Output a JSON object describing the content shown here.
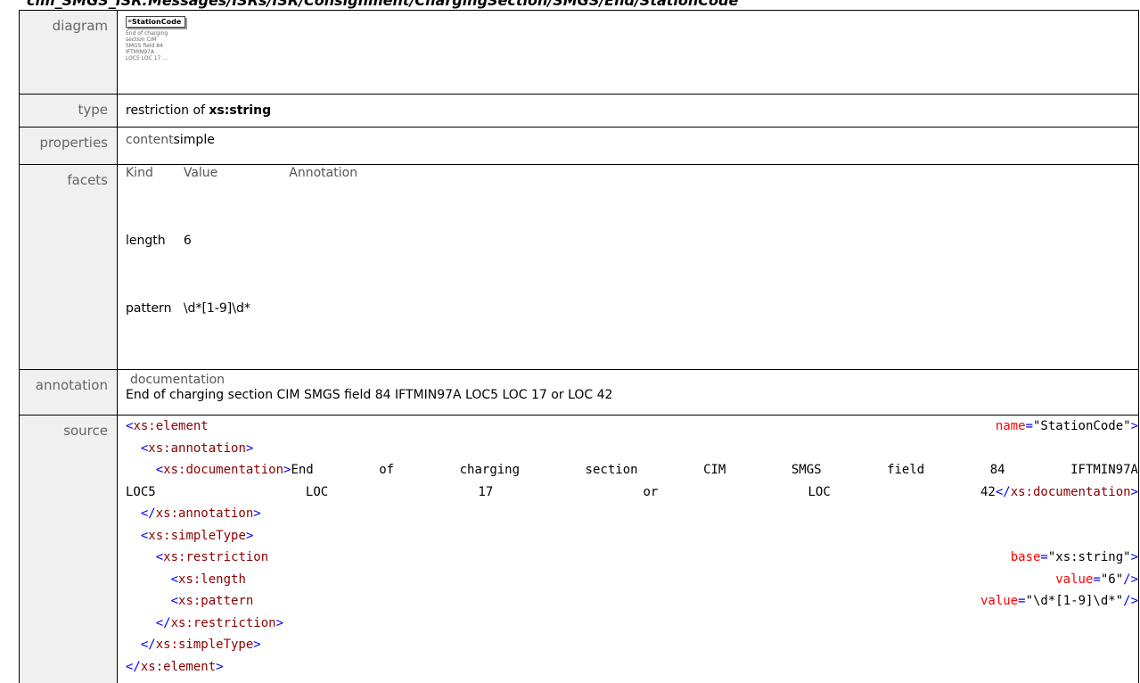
{
  "page_title": "cim_SMGS_ISR:Messages/ISRs/ISR/Consignment/ChargingSection/SMGS/End/StationCode",
  "labels": {
    "diagram": "diagram",
    "type": "type",
    "properties": "properties",
    "facets": "facets",
    "annotation": "annotation",
    "source": "source"
  },
  "diagram": {
    "element_name": "StationCode",
    "doc_lines": [
      "End of charging",
      "section CIM",
      "SMGS field 84",
      "IFTMIN97A",
      "LOC5 LOC 17 ..."
    ]
  },
  "type": {
    "prefix": "restriction of",
    "base": "xs:string"
  },
  "properties": {
    "key": "content",
    "value": "simple"
  },
  "facets": {
    "headers": [
      "Kind",
      "Value",
      "Annotation"
    ],
    "rows": [
      {
        "kind": "length",
        "value": "6"
      },
      {
        "kind": "pattern",
        "value": "\\d*[1-9]\\d*"
      }
    ]
  },
  "annotation": {
    "header": "documentation",
    "text": "End of charging section CIM SMGS field 84 IFTMIN97A LOC5 LOC 17 or LOC 42"
  },
  "source": {
    "l1_tag": "xs:element",
    "l1_attr": "name",
    "l1_val": "\"StationCode\"",
    "l2_tag": "xs:annotation",
    "l3_tag": "xs:documentation",
    "doc_words_1": [
      "End",
      "of",
      "charging",
      "section",
      "CIM",
      "SMGS",
      "field",
      "84",
      "IFTMIN97A"
    ],
    "doc_words_2": [
      "LOC5",
      "LOC",
      "17",
      "or",
      "LOC",
      "42"
    ],
    "l4_tag": "xs:documentation",
    "l5_tag": "xs:annotation",
    "l6_tag": "xs:simpleType",
    "l7_tag": "xs:restriction",
    "l7_attr": "base",
    "l7_val": "\"xs:string\"",
    "l8_tag": "xs:length",
    "l8_attr": "value",
    "l8_val": "\"6\"",
    "l9_tag": "xs:pattern",
    "l9_attr": "value",
    "l9_val": "\"\\d*[1-9]\\d*\"",
    "l10_tag": "xs:restriction",
    "l11_tag": "xs:simpleType",
    "l12_tag": "xs:element"
  }
}
